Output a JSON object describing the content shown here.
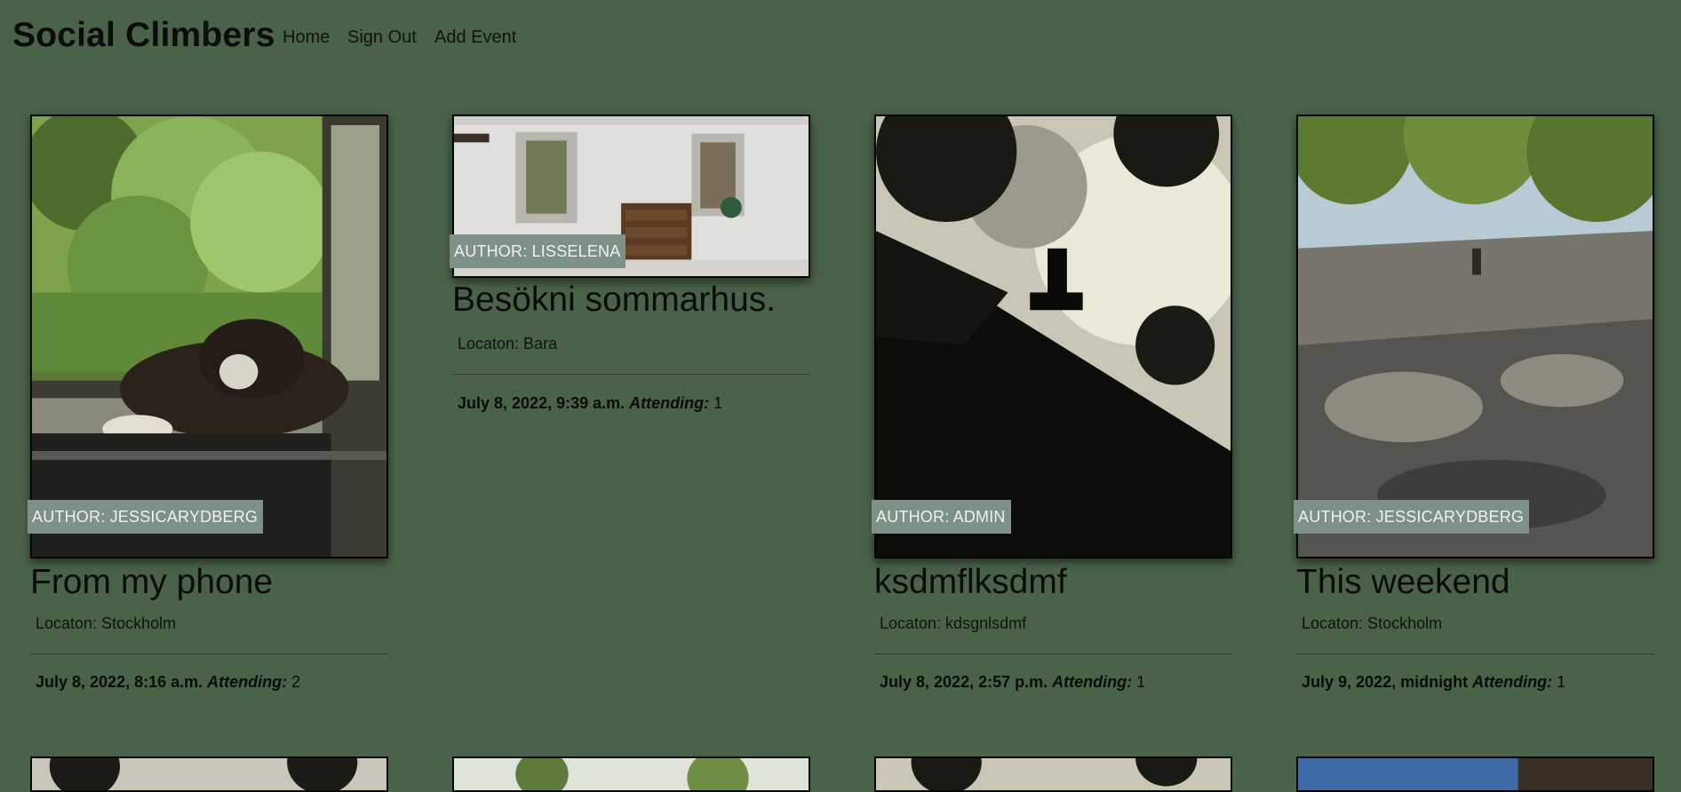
{
  "navbar": {
    "brand": "Social Climbers",
    "links": [
      "Home",
      "Sign Out",
      "Add Event"
    ]
  },
  "events": [
    {
      "author": "AUTHOR: JESSICARYDBERG",
      "title": "From my phone",
      "location": "Locaton: Stockholm",
      "datetime": "July 8, 2022, 8:16 a.m.",
      "attending_label": "Attending:",
      "attending_count": "2"
    },
    {
      "author": "AUTHOR: LISSELENA",
      "title": "Besökni sommarhus.",
      "location": "Locaton: Bara",
      "datetime": "July 8, 2022, 9:39 a.m.",
      "attending_label": "Attending:",
      "attending_count": "1"
    },
    {
      "author": "AUTHOR: ADMIN",
      "title": "ksdmflksdmf",
      "location": "Locaton: kdsgnlsdmf",
      "datetime": "July 8, 2022, 2:57 p.m.",
      "attending_label": "Attending:",
      "attending_count": "1"
    },
    {
      "author": "AUTHOR: JESSICARYDBERG",
      "title": "This weekend",
      "location": "Locaton: Stockholm",
      "datetime": "July 9, 2022, midnight",
      "attending_label": "Attending:",
      "attending_count": "1"
    }
  ]
}
